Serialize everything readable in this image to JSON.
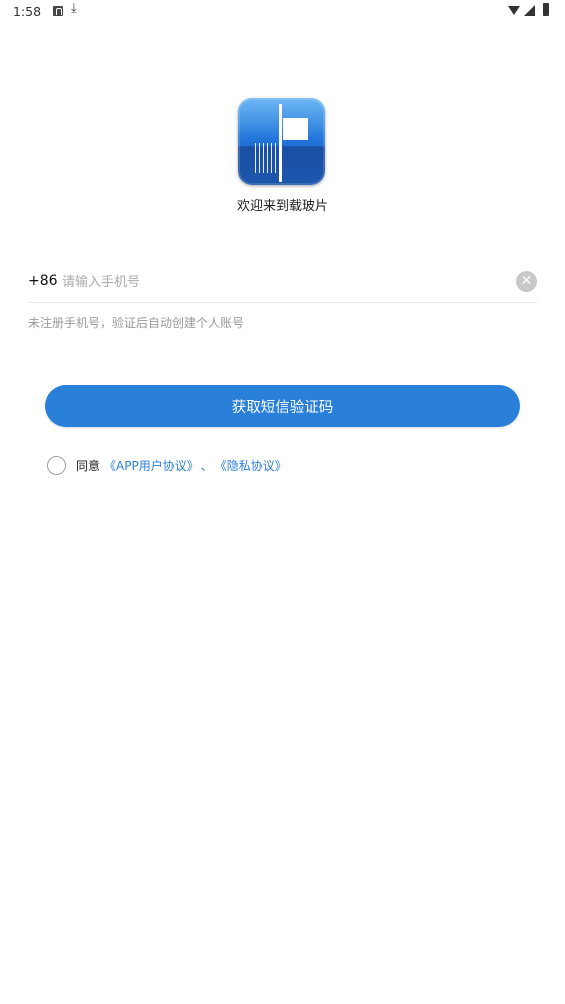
{
  "status_bar": {
    "time": "1:58",
    "icons": [
      "notification-a-icon",
      "download-icon",
      "wifi-icon",
      "signal-icon",
      "battery-icon"
    ]
  },
  "app": {
    "welcome_text": "欢迎来到载玻片"
  },
  "login": {
    "country_code": "+86",
    "phone_placeholder": "请输入手机号",
    "phone_value": "",
    "hint": "未注册手机号，验证后自动创建个人账号",
    "sms_button_label": "获取短信验证码"
  },
  "agreement": {
    "checked": false,
    "prefix": "同意",
    "user_agreement_link": "《APP用户协议》",
    "separator": "、",
    "privacy_link": "《隐私协议》"
  },
  "colors": {
    "accent": "#2a7fd8"
  }
}
